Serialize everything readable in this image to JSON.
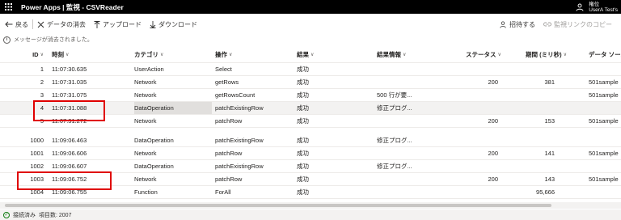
{
  "app_bar": {
    "title": "Power Apps  |  監視 - CSVReader",
    "user_line1": "権位",
    "user_line2": "UserA Test's"
  },
  "command_bar": {
    "back": "戻る",
    "clear": "データの消去",
    "upload": "アップロード",
    "download": "ダウンロード",
    "invite": "招待する",
    "copy_link": "監視リンクのコピー"
  },
  "info_bar": {
    "message": "メッセージが消去されました。"
  },
  "grid": {
    "columns": [
      "ID",
      "時刻",
      "カテゴリ",
      "操作",
      "結果",
      "結果情報",
      "ステータス",
      "期間 (ミリ秒)",
      "データ ソース"
    ],
    "rows": [
      {
        "id": "1",
        "time": "11:07:30.635",
        "category": "UserAction",
        "operation": "Select",
        "result": "成功",
        "detail": "",
        "status": "",
        "duration": "",
        "source": ""
      },
      {
        "id": "2",
        "time": "11:07:31.035",
        "category": "Network",
        "operation": "getRows",
        "result": "成功",
        "detail": "",
        "status": "200",
        "duration": "381",
        "source": "501sample"
      },
      {
        "id": "3",
        "time": "11:07:31.075",
        "category": "Network",
        "operation": "getRowsCount",
        "result": "成功",
        "detail": "500 行が要...",
        "status": "",
        "duration": "",
        "source": "501sample"
      },
      {
        "id": "4",
        "time": "11:07:31.088",
        "category": "DataOperation",
        "operation": "patchExistingRow",
        "result": "成功",
        "detail": "修正プログ...",
        "status": "",
        "duration": "",
        "source": ""
      },
      {
        "id": "5",
        "time": "11:07:31.272",
        "category": "Network",
        "operation": "patchRow",
        "result": "成功",
        "detail": "",
        "status": "200",
        "duration": "153",
        "source": "501sample"
      }
    ],
    "rows_lower": [
      {
        "id": "1000",
        "time": "11:09:06.463",
        "category": "DataOperation",
        "operation": "patchExistingRow",
        "result": "成功",
        "detail": "修正プログ...",
        "status": "",
        "duration": "",
        "source": ""
      },
      {
        "id": "1001",
        "time": "11:09:06.606",
        "category": "Network",
        "operation": "patchRow",
        "result": "成功",
        "detail": "",
        "status": "200",
        "duration": "141",
        "source": "501sample"
      },
      {
        "id": "1002",
        "time": "11:09:06.607",
        "category": "DataOperation",
        "operation": "patchExistingRow",
        "result": "成功",
        "detail": "修正プログ...",
        "status": "",
        "duration": "",
        "source": ""
      },
      {
        "id": "1003",
        "time": "11:09:06.752",
        "category": "Network",
        "operation": "patchRow",
        "result": "成功",
        "detail": "",
        "status": "200",
        "duration": "143",
        "source": "501sample"
      },
      {
        "id": "1004",
        "time": "11:09:06.755",
        "category": "Function",
        "operation": "ForAll",
        "result": "成功",
        "detail": "",
        "status": "",
        "duration": "95,666",
        "source": ""
      }
    ]
  },
  "status_bar": {
    "connection": "接続済み",
    "item_count": "項目数: 2007"
  },
  "colors": {
    "app_bar_bg": "#000000",
    "highlight_box": "#e00000",
    "selected_row": "#f3f2f1"
  }
}
